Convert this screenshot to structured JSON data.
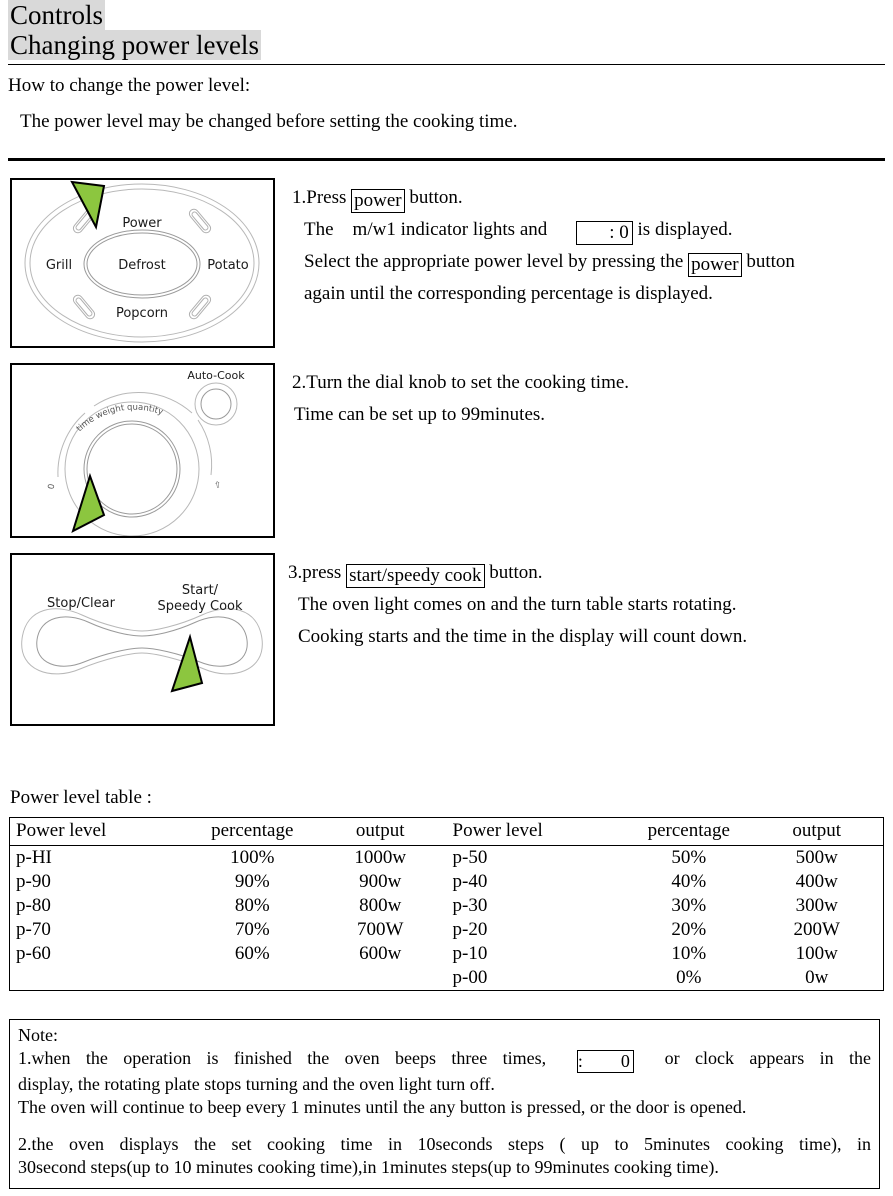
{
  "document": {
    "heading": "Controls",
    "subheading": "Changing power levels",
    "intro_line1": "How to change the power level:",
    "intro_line2": "The power level may be changed before setting the cooking time."
  },
  "panels": [
    {
      "name": "control-dial-panel",
      "labels": {
        "top": "Power",
        "left": "Grill",
        "center": "Defrost",
        "right": "Potato",
        "bottom": "Popcorn"
      }
    },
    {
      "name": "knob-panel",
      "labels": {
        "auto_cook": "Auto-Cook",
        "arc_text": "time weight quantity",
        "zero_mark": "0"
      }
    },
    {
      "name": "buttons-panel",
      "labels": {
        "stop_clear": "Stop/Clear",
        "start_line1": "Start/",
        "start_line2": "Speedy Cook"
      }
    }
  ],
  "steps": {
    "step1": {
      "line1_pre": "1.Press ",
      "line1_button": "power",
      "line1_post": " button.",
      "line2_pre": "The    m/w1 indicator lights and      ",
      "line2_display": ": 0",
      "line2_post": " is displayed.",
      "line3_pre": "Select the appropriate power level by pressing the ",
      "line3_button": "power",
      "line3_post": " button",
      "line4": "again until the corresponding percentage is displayed."
    },
    "step2": {
      "line1": "2.Turn the dial knob to set the cooking time.",
      "line2": "Time can be set up to 99minutes."
    },
    "step3": {
      "line1_pre": "3.press ",
      "line1_button": "start/speedy cook",
      "line1_post": " button.",
      "line2": "The oven light comes on and the turn table starts rotating.",
      "line3": "Cooking starts and the time in the display will count down."
    }
  },
  "power_table": {
    "caption": "Power level table :",
    "headers": [
      "Power level",
      "percentage",
      "output"
    ],
    "left_rows": [
      [
        "p-HI",
        "100%",
        "1000w"
      ],
      [
        "p-90",
        "90%",
        "900w"
      ],
      [
        "p-80",
        "80%",
        "800w"
      ],
      [
        "p-70",
        "70%",
        "700W"
      ],
      [
        "p-60",
        "60%",
        "600w"
      ]
    ],
    "right_rows": [
      [
        "p-50",
        "50%",
        "500w"
      ],
      [
        "p-40",
        "40%",
        "400w"
      ],
      [
        "p-30",
        "30%",
        "300w"
      ],
      [
        "p-20",
        "20%",
        "200W"
      ],
      [
        "p-10",
        "10%",
        "100w"
      ],
      [
        "p-00",
        "0%",
        "0w"
      ]
    ]
  },
  "note": {
    "title": "Note:",
    "item1_pre": "1.when  the  operation  is  finished  the  oven  beeps  three  times,",
    "item1_display": ": 0",
    "item1_mid": "or  clock  appears  in  the",
    "item1_line2": "display, the rotating plate stops turning and the oven light turn off.",
    "item1_line3": "The oven will continue to beep every 1 minutes until the any button is pressed, or the door is opened.",
    "item2_line1": "2.the  oven  displays  the  set  cooking  time  in  10seconds  steps  (  up  to  5minutes  cooking  time),  in",
    "item2_line2": "30second steps(up to 10 minutes cooking time),in 1minutes steps(up to 99minutes cooking time)."
  },
  "colors": {
    "highlight": "#d9d9d9",
    "arrow_green": "#8CC63F",
    "diagram_line": "#b8b8b8"
  }
}
